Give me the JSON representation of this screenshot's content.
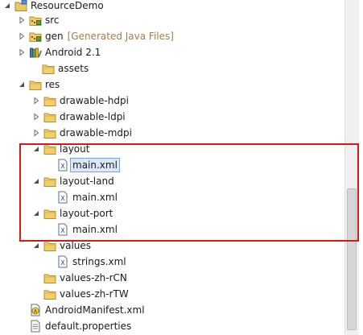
{
  "tree": {
    "items": [
      {
        "label": "ResourceDemo",
        "decoration": "",
        "icon": "project-icon",
        "toggle": "expanded"
      },
      {
        "label": "src",
        "decoration": "",
        "icon": "source-folder-icon",
        "toggle": "collapsed"
      },
      {
        "label": "gen",
        "decoration": "[Generated Java Files]",
        "icon": "source-folder-icon",
        "toggle": "collapsed"
      },
      {
        "label": "Android 2.1",
        "decoration": "",
        "icon": "library-icon",
        "toggle": "collapsed"
      },
      {
        "label": "assets",
        "decoration": "",
        "icon": "folder-icon",
        "toggle": "none"
      },
      {
        "label": "res",
        "decoration": "",
        "icon": "folder-icon",
        "toggle": "expanded"
      },
      {
        "label": "drawable-hdpi",
        "decoration": "",
        "icon": "folder-icon",
        "toggle": "collapsed"
      },
      {
        "label": "drawable-ldpi",
        "decoration": "",
        "icon": "folder-icon",
        "toggle": "collapsed"
      },
      {
        "label": "drawable-mdpi",
        "decoration": "",
        "icon": "folder-icon",
        "toggle": "collapsed"
      },
      {
        "label": "layout",
        "decoration": "",
        "icon": "folder-icon",
        "toggle": "expanded"
      },
      {
        "label": "main.xml",
        "decoration": "",
        "icon": "xml-file-icon",
        "toggle": "none",
        "selected": true
      },
      {
        "label": "layout-land",
        "decoration": "",
        "icon": "folder-icon",
        "toggle": "expanded"
      },
      {
        "label": "main.xml",
        "decoration": "",
        "icon": "xml-file-icon",
        "toggle": "none"
      },
      {
        "label": "layout-port",
        "decoration": "",
        "icon": "folder-icon",
        "toggle": "expanded"
      },
      {
        "label": "main.xml",
        "decoration": "",
        "icon": "xml-file-icon",
        "toggle": "none"
      },
      {
        "label": "values",
        "decoration": "",
        "icon": "folder-icon",
        "toggle": "expanded"
      },
      {
        "label": "strings.xml",
        "decoration": "",
        "icon": "xml-file-icon",
        "toggle": "none"
      },
      {
        "label": "values-zh-rCN",
        "decoration": "",
        "icon": "folder-icon",
        "toggle": "none"
      },
      {
        "label": "values-zh-rTW",
        "decoration": "",
        "icon": "folder-icon",
        "toggle": "none"
      },
      {
        "label": "AndroidManifest.xml",
        "decoration": "",
        "icon": "manifest-file-icon",
        "toggle": "none"
      },
      {
        "label": "default.properties",
        "decoration": "",
        "icon": "properties-file-icon",
        "toggle": "none"
      }
    ]
  },
  "colors": {
    "highlight_border": "#d01c1c",
    "decoration_text": "#9a7f52",
    "selection_bg": "#d9e8fb",
    "folder_yellow": "#f2cf6b"
  }
}
